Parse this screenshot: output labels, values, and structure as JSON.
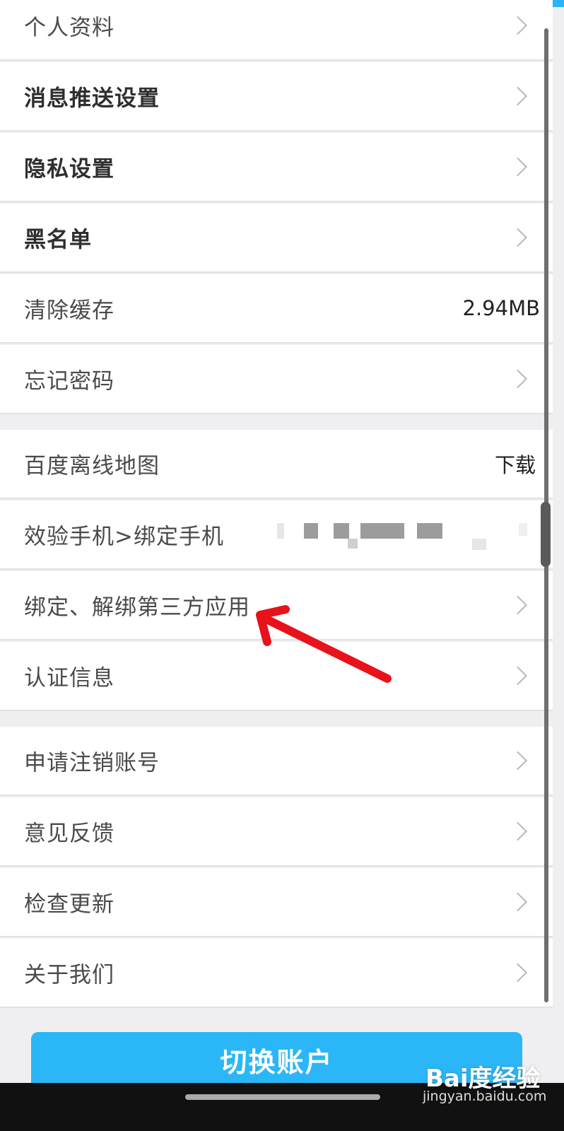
{
  "settings": {
    "group1": [
      {
        "label": "个人资料",
        "bold": true,
        "chevron": true
      },
      {
        "label": "消息推送设置",
        "bold": true,
        "chevron": true
      },
      {
        "label": "隐私设置",
        "bold": true,
        "chevron": true
      },
      {
        "label": "黑名单",
        "bold": true,
        "chevron": true
      },
      {
        "label": "清除缓存",
        "bold": false,
        "value": "2.94MB"
      },
      {
        "label": "忘记密码",
        "bold": false,
        "chevron": true
      }
    ],
    "group2": [
      {
        "label": "百度离线地图",
        "value": "下载"
      },
      {
        "label": "效验手机>绑定手机",
        "value_blurred": true
      },
      {
        "label": "绑定、解绑第三方应用",
        "chevron": true
      },
      {
        "label": "认证信息",
        "chevron": true
      }
    ],
    "group3": [
      {
        "label": "申请注销账号",
        "chevron": true
      },
      {
        "label": "意见反馈",
        "chevron": true
      },
      {
        "label": "检查更新",
        "chevron": true
      },
      {
        "label": "关于我们",
        "chevron": true
      }
    ]
  },
  "switch_button": "切换账户",
  "watermark": {
    "brand": "Bai度经验",
    "url": "jingyan.baidu.com"
  },
  "colors": {
    "accent": "#2bb7f7",
    "annotation": "#e8121b"
  },
  "annotation": {
    "type": "arrow",
    "points_to": "绑定、解绑第三方应用"
  }
}
